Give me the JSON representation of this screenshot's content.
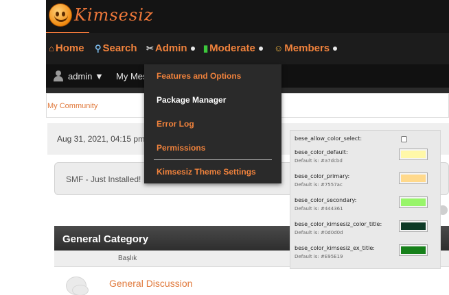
{
  "logo": {
    "text": "Kimsesiz"
  },
  "nav": {
    "items": [
      {
        "label": "Home",
        "icon": "home-icon",
        "has_dropdown": false
      },
      {
        "label": "Search",
        "icon": "search-icon",
        "has_dropdown": false
      },
      {
        "label": "Admin",
        "icon": "admin-tools-icon",
        "has_dropdown": true
      },
      {
        "label": "Moderate",
        "icon": "traffic-light-icon",
        "has_dropdown": true
      },
      {
        "label": "Members",
        "icon": "members-icon",
        "has_dropdown": true
      }
    ]
  },
  "userbar": {
    "username": "admin ▼",
    "my_messages": "My Mes"
  },
  "breadcrumb": {
    "community": "My Community"
  },
  "content": {
    "date": "Aug 31, 2021, 04:15 pm",
    "news": "SMF - Just Installed!",
    "category": "General Category",
    "subheader": "Başlık",
    "board_name": "General Discussion"
  },
  "admin_menu": {
    "items": [
      {
        "label": "Features and Options",
        "color": "#f0823c"
      },
      {
        "label": "Package Manager",
        "color": "#ffffff"
      },
      {
        "label": "Error Log",
        "color": "#f0823c"
      },
      {
        "label": "Permissions",
        "color": "#f0823c"
      },
      {
        "label": "Kimsesiz Theme Settings",
        "color": "#f0823c"
      }
    ]
  },
  "theme_settings": {
    "rows": [
      {
        "label": "bese_allow_color_select:",
        "default": "",
        "type": "checkbox",
        "checked": false
      },
      {
        "label": "bese_color_default:",
        "default": "Default is: #a7dcbd",
        "type": "color",
        "swatch": "#fff8a8"
      },
      {
        "label": "bese_color_primary:",
        "default": "Default is: #7557ac",
        "type": "color",
        "swatch": "#ffd98c"
      },
      {
        "label": "bese_color_secondary:",
        "default": "Default is: #444361",
        "type": "color",
        "swatch": "#98f56a"
      },
      {
        "label": "bese_color_kimsesiz_color_title:",
        "default": "Default is: #0d0d0d",
        "type": "color",
        "swatch": "#0d3a26"
      },
      {
        "label": "bese_color_kimsesiz_ex_title:",
        "default": "Default is: #E95E19",
        "type": "color",
        "swatch": "#16801a"
      }
    ]
  },
  "colors": {
    "accent": "#f0823c",
    "dark_bg": "#141414"
  }
}
